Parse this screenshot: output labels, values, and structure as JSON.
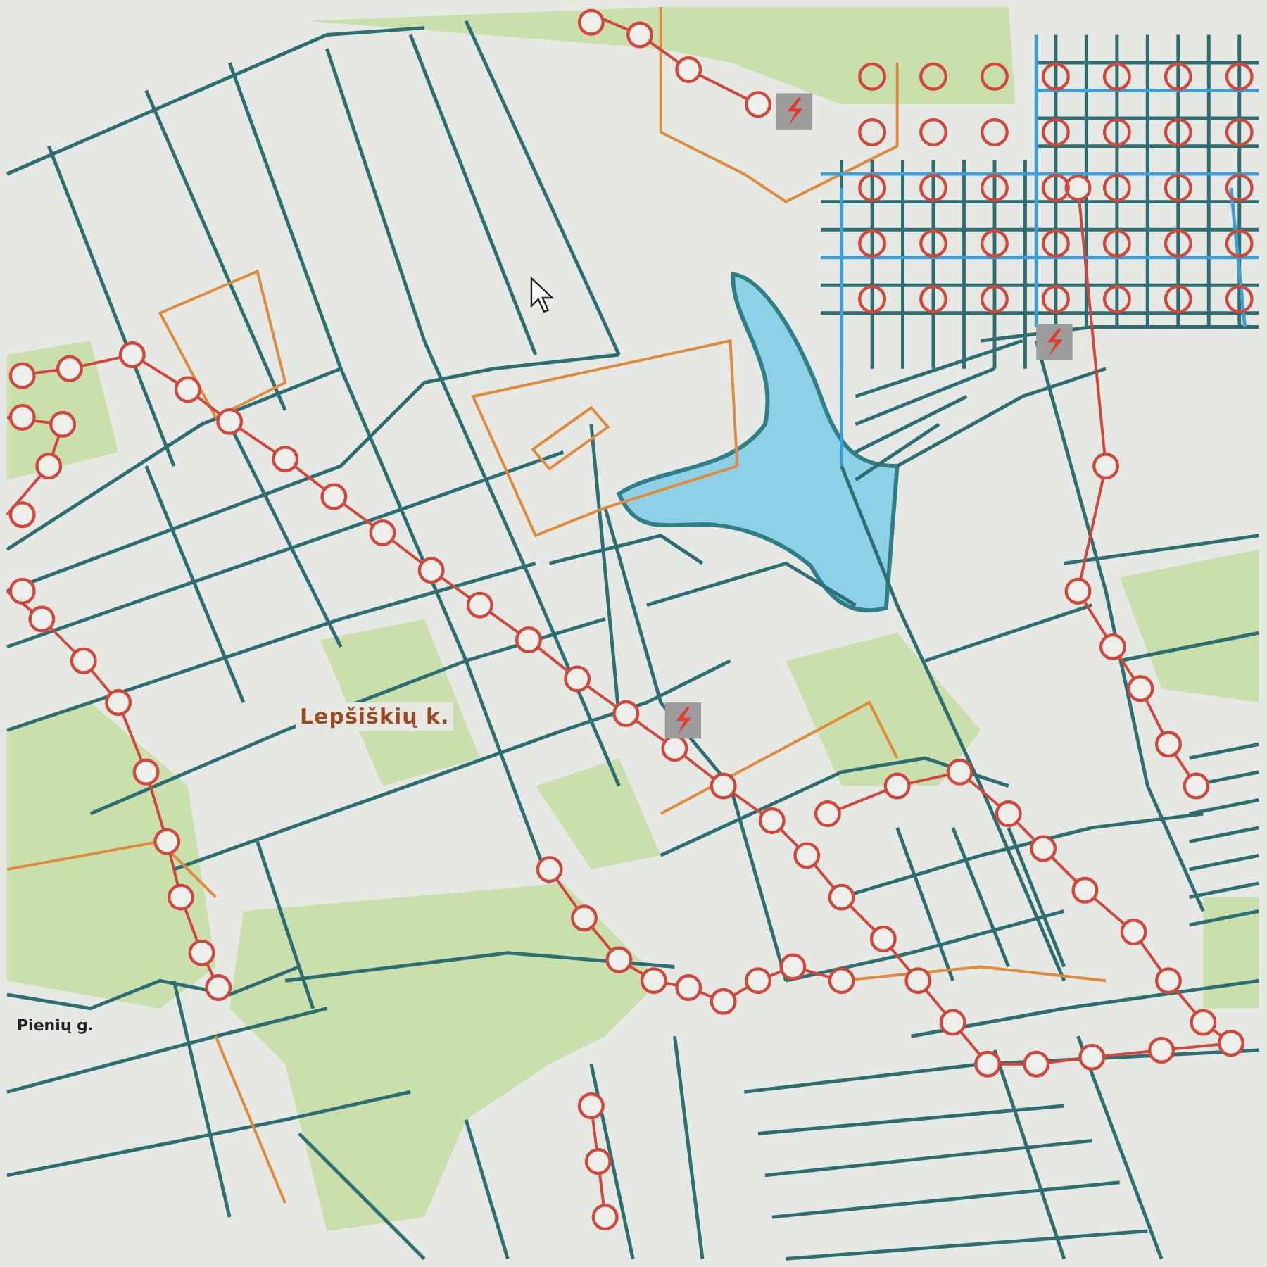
{
  "map": {
    "labels": [
      {
        "text": "Lepšiškių k.",
        "kind": "village"
      },
      {
        "text": "Pienių g.",
        "kind": "street"
      }
    ]
  }
}
